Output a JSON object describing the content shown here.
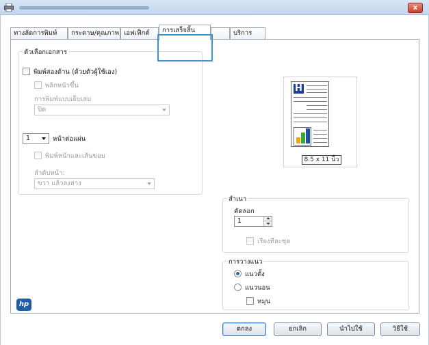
{
  "window": {
    "close_label": "x"
  },
  "tabs": [
    {
      "label": "ทางลัดการพิมพ์",
      "active": false
    },
    {
      "label": "กระดาษ/คุณภาพ",
      "active": false
    },
    {
      "label": "เอฟเฟ็กต์",
      "active": false
    },
    {
      "label": "การเสร็จสิ้น",
      "active": true
    },
    {
      "label": "",
      "active": false
    },
    {
      "label": "บริการ",
      "active": false
    }
  ],
  "document_options": {
    "title": "ตัวเลือกเอกสาร",
    "duplex_label": "พิมพ์สองด้าน (ด้วยตัวผู้ใช้เอง)",
    "flip_pages_label": "พลิกหน้าขึ้น",
    "booklet_label": "การพิมพ์แบบเย็บเล่ม",
    "booklet_value": "ปิด",
    "pages_per_sheet_value": "1",
    "pages_per_sheet_label": "หน้าต่อแผ่น",
    "print_borders_label": "พิมพ์หน้าและเส้นขอบ",
    "page_order_label": "ลำดับหน้า:",
    "page_order_value": "ขวา แล้วลงล่าง"
  },
  "preview": {
    "letter": "H",
    "size_label": "8.5 x 11 นิ้ว"
  },
  "copies": {
    "title": "สำเนา",
    "count_label": "คัดลอก",
    "count_value": "1",
    "collate_label": "เรียงทีละชุด"
  },
  "orientation": {
    "title": "การวางแนว",
    "portrait_label": "แนวตั้ง",
    "landscape_label": "แนวนอน",
    "rotate_label": "หมุน",
    "selected": "portrait"
  },
  "logo_text": "hp",
  "buttons": {
    "ok": "ตกลง",
    "cancel": "ยกเลิก",
    "apply": "นำไปใช้",
    "help": "วิธีใช้"
  }
}
